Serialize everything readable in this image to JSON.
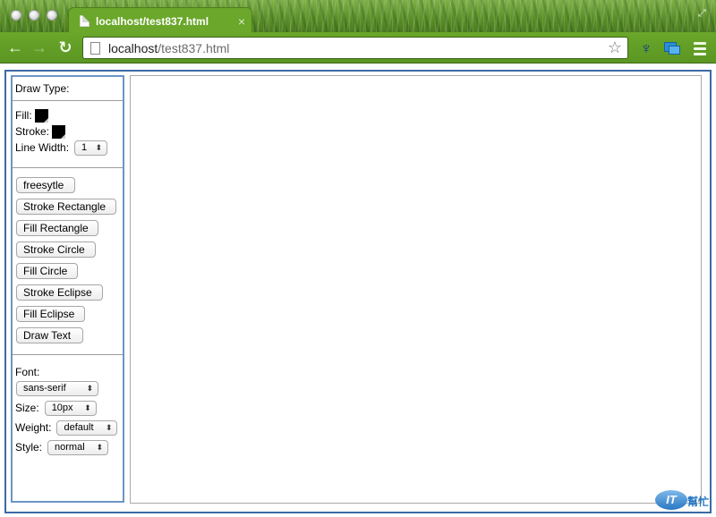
{
  "browser": {
    "tab_title": "localhost/test837.html",
    "tab_close": "×",
    "url_host": "localhost",
    "url_path": "/test837.html",
    "back": "←",
    "forward": "→",
    "reload": "↻",
    "star": "☆"
  },
  "panel": {
    "draw_type_label": "Draw Type:",
    "fill_label": "Fill:",
    "fill_color": "#000000",
    "stroke_label": "Stroke:",
    "stroke_color": "#000000",
    "line_width_label": "Line Width:",
    "line_width_value": "1",
    "buttons": [
      "freesytle",
      "Stroke Rectangle",
      "Fill Rectangle",
      "Stroke Circle",
      "Fill Circle",
      "Stroke Eclipse",
      "Fill Eclipse",
      "Draw Text"
    ],
    "font_label": "Font:",
    "font_value": "sans-serif",
    "size_label": "Size:",
    "size_value": "10px",
    "weight_label": "Weight:",
    "weight_value": "default",
    "style_label": "Style:",
    "style_value": "normal"
  },
  "watermark": {
    "logo": "IT",
    "text": "幫忙"
  }
}
